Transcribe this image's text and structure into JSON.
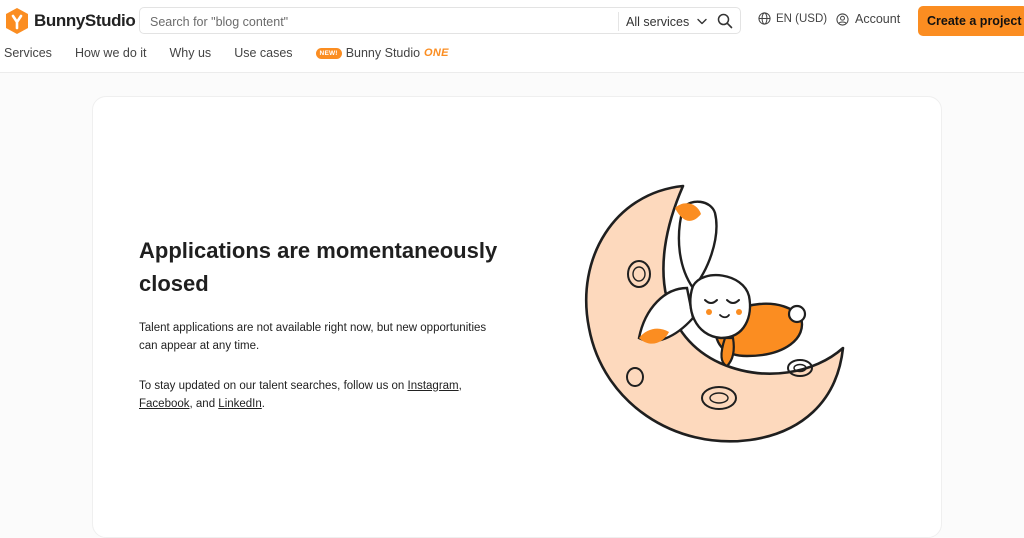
{
  "header": {
    "logo_text": "BunnyStudio",
    "search": {
      "placeholder": "Search for \"blog content\"",
      "value": ""
    },
    "services_select": {
      "label": "All services"
    },
    "language": {
      "label": "EN (USD)"
    },
    "account": {
      "label": "Account"
    },
    "cta": {
      "label": "Create a project"
    }
  },
  "nav": {
    "items": [
      {
        "label": "Services"
      },
      {
        "label": "How we do it"
      },
      {
        "label": "Why us"
      },
      {
        "label": "Use cases"
      }
    ],
    "one": {
      "badge": "NEW!",
      "label": "Bunny Studio",
      "suffix": "ONE"
    }
  },
  "main": {
    "title": "Applications are momentaneously closed",
    "paragraph1": "Talent applications are not available right now, but new opportunities can appear at any time.",
    "paragraph2": {
      "prefix": "To stay updated on our talent searches, follow us on ",
      "link_instagram": "Instagram",
      "comma": ",",
      "link_facebook": "Facebook",
      "and_text": ", and ",
      "link_linkedin": "LinkedIn",
      "period": "."
    }
  },
  "colors": {
    "accent": "#fb8d21",
    "moon_fill": "#fdd9bd",
    "outline": "#1f1f1f"
  },
  "icons": [
    "bunny-logo-icon",
    "chevron-down-icon",
    "search-icon",
    "globe-icon",
    "account-icon"
  ]
}
